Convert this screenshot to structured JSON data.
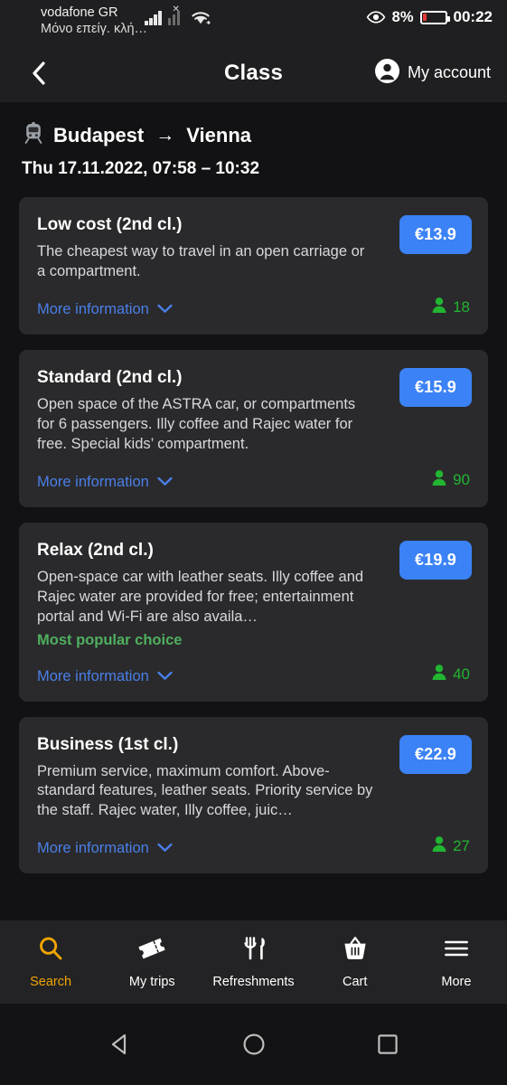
{
  "statusbar": {
    "carrier_line1": "vodafone GR",
    "carrier_line2": "Μόνο επείγ. κλή…",
    "battery_percent": "8%",
    "clock": "00:22",
    "battery_color": "#E53935"
  },
  "appbar": {
    "title": "Class",
    "back_label": "Back",
    "account_label": "My account"
  },
  "journey": {
    "from": "Budapest",
    "arrow": "→",
    "to": "Vienna",
    "datetime": "Thu 17.11.2022, 07:58 – 10:32"
  },
  "colors": {
    "price_badge": "#3B82F6",
    "seats_green": "#21B531",
    "popular_green": "#4FAF5F",
    "link_blue": "#4A7FE8",
    "active_nav": "#F0A500",
    "card_bg": "#2A2A2C",
    "page_bg": "#121214"
  },
  "more_information_label": "More information",
  "classes": [
    {
      "title": "Low cost (2nd cl.)",
      "description": "The cheapest way to travel in an open carriage or a compartment.",
      "price": "€13.9",
      "seats": "18",
      "badge": ""
    },
    {
      "title": "Standard (2nd cl.)",
      "description": "Open space of the ASTRA car, or compartments for 6 passengers. Illy coffee and Rajec water for free. Special kids’ compartment.",
      "price": "€15.9",
      "seats": "90",
      "badge": ""
    },
    {
      "title": "Relax (2nd cl.)",
      "description": "Open-space car with leather seats. Illy coffee and Rajec water are provided for free; entertainment portal and Wi-Fi are also availa…",
      "price": "€19.9",
      "seats": "40",
      "badge": "Most popular choice"
    },
    {
      "title": "Business (1st cl.)",
      "description": "Premium service, maximum comfort. Above-standard features, leather seats. Priority service by the staff. Rajec water, Illy coffee, juic…",
      "price": "€22.9",
      "seats": "27",
      "badge": ""
    }
  ],
  "bottomnav": [
    {
      "label": "Search",
      "icon": "search-icon",
      "active": true
    },
    {
      "label": "My trips",
      "icon": "ticket-icon",
      "active": false
    },
    {
      "label": "Refreshments",
      "icon": "cutlery-icon",
      "active": false
    },
    {
      "label": "Cart",
      "icon": "basket-icon",
      "active": false
    },
    {
      "label": "More",
      "icon": "hamburger-icon",
      "active": false
    }
  ],
  "sysnav": [
    {
      "icon": "android-back-icon"
    },
    {
      "icon": "android-home-icon"
    },
    {
      "icon": "android-recents-icon"
    }
  ]
}
